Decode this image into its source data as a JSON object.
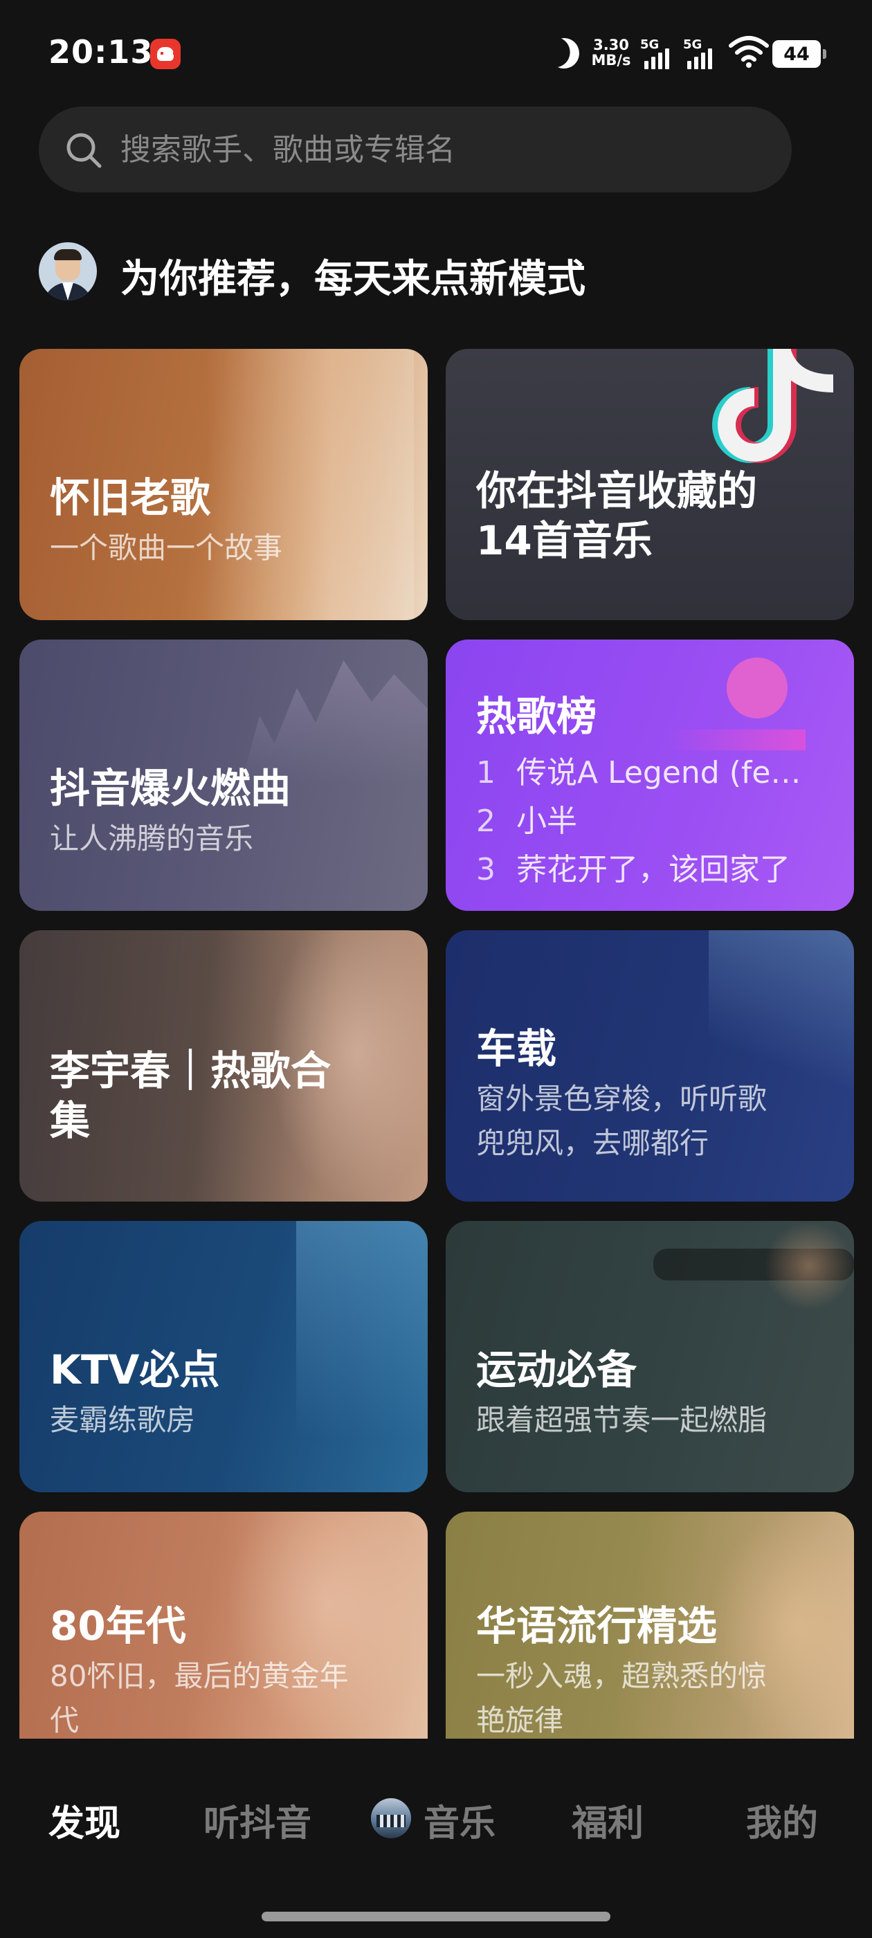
{
  "status_bar": {
    "time": "20:13",
    "net_speed_value": "3.30",
    "net_speed_unit": "MB/s",
    "sim1_label": "5G",
    "sim2_label": "5G",
    "battery": "44"
  },
  "search": {
    "placeholder": "搜索歌手、歌曲或专辑名"
  },
  "recommend": {
    "title": "为你推荐，每天来点新模式"
  },
  "cards": [
    {
      "title": "怀旧老歌",
      "subtitle": "一个歌曲一个故事"
    },
    {
      "title_lines": [
        "你在抖音收藏的",
        "14首音乐"
      ]
    },
    {
      "title": "抖音爆火燃曲",
      "subtitle": "让人沸腾的音乐"
    },
    {
      "title": "热歌榜",
      "items": [
        {
          "rank": "1",
          "name": "传说A Legend (fe…"
        },
        {
          "rank": "2",
          "name": "小半"
        },
        {
          "rank": "3",
          "name": "荞花开了，该回家了"
        }
      ]
    },
    {
      "title_lines": [
        "李宇春｜热歌合",
        "集"
      ]
    },
    {
      "title": "车载",
      "subtitle_lines": [
        "窗外景色穿梭，听听歌",
        "兜兜风，去哪都行"
      ]
    },
    {
      "title": "KTV必点",
      "subtitle": "麦霸练歌房"
    },
    {
      "title": "运动必备",
      "subtitle": "跟着超强节奏一起燃脂"
    },
    {
      "title": "80年代",
      "subtitle_lines": [
        "80怀旧，最后的黄金年",
        "代"
      ]
    },
    {
      "title": "华语流行精选",
      "subtitle_lines": [
        "一秒入魂，超熟悉的惊",
        "艳旋律"
      ]
    }
  ],
  "nav": {
    "discover": "发现",
    "listen_douyin": "听抖音",
    "music": "音乐",
    "welfare": "福利",
    "mine": "我的"
  },
  "icons": [
    "search-icon",
    "moon-icon",
    "wifi-icon",
    "signal-icon",
    "battery-icon",
    "app-notification-icon",
    "music-note-icon"
  ],
  "colors": {
    "background": "#131313",
    "nav_active": "#ffffff",
    "nav_inactive": "#7a7a7a",
    "hot_list_card": "#9b4ff3"
  }
}
